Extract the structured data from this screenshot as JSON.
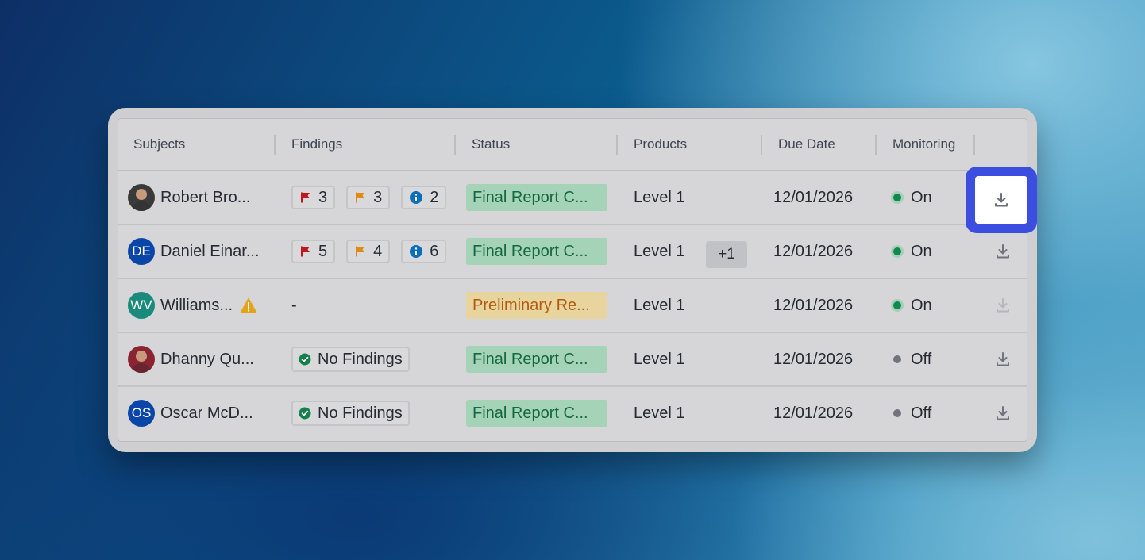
{
  "table": {
    "headers": [
      "Subjects",
      "Findings",
      "Status",
      "Products",
      "Due Date",
      "Monitoring"
    ],
    "rows": [
      {
        "subject": "Robert Bro...",
        "avatar_initials": "",
        "avatar_color": "#3a3a3a",
        "warning": false,
        "findings": [
          {
            "icon": "red-flag-icon",
            "count": "3"
          },
          {
            "icon": "orange-flag-icon",
            "count": "3"
          },
          {
            "icon": "info-icon",
            "count": "2"
          }
        ],
        "findings_text": "",
        "status": "Final Report C...",
        "status_tone": "green",
        "product": "Level 1",
        "product_more": "",
        "due_date": "12/01/2026",
        "monitoring": "On",
        "download_enabled": true
      },
      {
        "subject": "Daniel Einar...",
        "avatar_initials": "DE",
        "avatar_color": "#0a45a8",
        "warning": false,
        "findings": [
          {
            "icon": "red-flag-icon",
            "count": "5"
          },
          {
            "icon": "orange-flag-icon",
            "count": "4"
          },
          {
            "icon": "info-icon",
            "count": "6"
          }
        ],
        "findings_text": "",
        "status": "Final Report C...",
        "status_tone": "green",
        "product": "Level 1",
        "product_more": "+1",
        "due_date": "12/01/2026",
        "monitoring": "On",
        "download_enabled": true
      },
      {
        "subject": "Williams...",
        "avatar_initials": "WV",
        "avatar_color": "#1a8a7c",
        "warning": true,
        "findings": [],
        "findings_text": "-",
        "status": "Preliminary Re...",
        "status_tone": "amber",
        "product": "Level 1",
        "product_more": "",
        "due_date": "12/01/2026",
        "monitoring": "On",
        "download_enabled": false
      },
      {
        "subject": "Dhanny Qu...",
        "avatar_initials": "",
        "avatar_color": "#8a2432",
        "warning": false,
        "findings": [],
        "findings_text": "No Findings",
        "status": "Final Report C...",
        "status_tone": "green",
        "product": "Level 1",
        "product_more": "",
        "due_date": "12/01/2026",
        "monitoring": "Off",
        "download_enabled": true
      },
      {
        "subject": "Oscar McD...",
        "avatar_initials": "OS",
        "avatar_color": "#0a45a8",
        "warning": false,
        "findings": [],
        "findings_text": "No Findings",
        "status": "Final Report C...",
        "status_tone": "green",
        "product": "Level 1",
        "product_more": "",
        "due_date": "12/01/2026",
        "monitoring": "Off",
        "download_enabled": true
      }
    ]
  },
  "colors": {
    "highlight": "#3b4ee0",
    "on_dot": "#0f8a4e",
    "off_dot": "#71737d",
    "status_green_bg": "#a4d3b7",
    "status_amber_bg": "#e8d49d"
  },
  "icons": {
    "download": "download-icon",
    "warning": "warning-icon",
    "check": "check-badge-icon"
  }
}
